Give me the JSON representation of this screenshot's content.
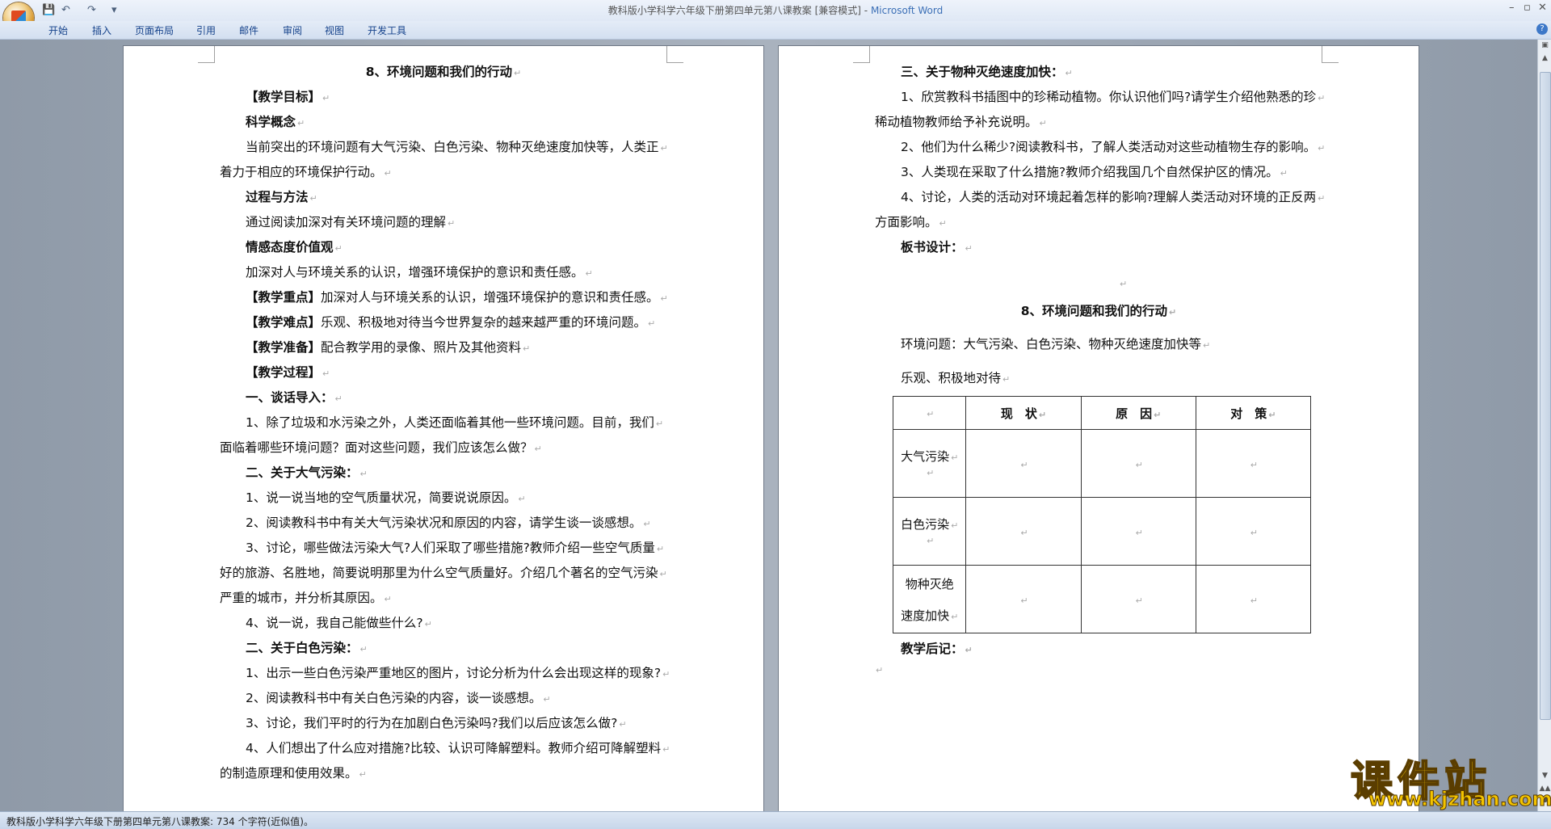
{
  "window": {
    "title": "教科版小学科学六年级下册第四单元第八课教案 [兼容模式]",
    "app_name": "Microsoft Word",
    "quick_access": [
      "save-icon",
      "undo-icon",
      "redo-icon",
      "customize-icon"
    ]
  },
  "ribbon": {
    "tabs": [
      "开始",
      "插入",
      "页面布局",
      "引用",
      "邮件",
      "审阅",
      "视图",
      "开发工具"
    ]
  },
  "page1": {
    "lines": [
      {
        "text": "8、环境问题和我们的行动",
        "bold": true,
        "style": "title"
      },
      {
        "text": "【教学目标】",
        "bold": true,
        "style": "indent"
      },
      {
        "text": "科学概念",
        "bold": true,
        "style": "indent"
      },
      {
        "text": "当前突出的环境问题有大气污染、白色污染、物种灭绝速度加快等，人类正",
        "bold": false,
        "style": "indent"
      },
      {
        "text": "着力于相应的环境保护行动。",
        "bold": false,
        "style": "flush"
      },
      {
        "text": "过程与方法",
        "bold": true,
        "style": "indent"
      },
      {
        "text": "通过阅读加深对有关环境问题的理解",
        "bold": false,
        "style": "indent"
      },
      {
        "text": "情感态度价值观",
        "bold": true,
        "style": "indent"
      },
      {
        "text": "加深对人与环境关系的认识，增强环境保护的意识和责任感。",
        "bold": false,
        "style": "indent"
      },
      {
        "label": "【教学重点】",
        "text": "加深对人与环境关系的认识，增强环境保护的意识和责任感。",
        "style": "indent"
      },
      {
        "label": "【教学难点】",
        "text": "乐观、积极地对待当今世界复杂的越来越严重的环境问题。",
        "style": "indent"
      },
      {
        "label": "【教学准备】",
        "text": "配合教学用的录像、照片及其他资料",
        "style": "indent"
      },
      {
        "text": "【教学过程】",
        "bold": true,
        "style": "indent"
      },
      {
        "text": "一、谈话导入：",
        "bold": true,
        "style": "indent"
      },
      {
        "text": "1、除了垃圾和水污染之外，人类还面临着其他一些环境问题。目前，我们",
        "bold": false,
        "style": "indent"
      },
      {
        "text": "面临着哪些环境问题？面对这些问题，我们应该怎么做？",
        "bold": false,
        "style": "flush"
      },
      {
        "text": "二、关于大气污染：",
        "bold": true,
        "style": "indent"
      },
      {
        "text": "1、说一说当地的空气质量状况，简要说说原因。",
        "bold": false,
        "style": "indent"
      },
      {
        "text": "2、阅读教科书中有关大气污染状况和原因的内容，请学生谈一谈感想。",
        "bold": false,
        "style": "indent"
      },
      {
        "text": "3、讨论，哪些做法污染大气?人们采取了哪些措施?教师介绍一些空气质量",
        "bold": false,
        "style": "indent"
      },
      {
        "text": "好的旅游、名胜地，简要说明那里为什么空气质量好。介绍几个著名的空气污染",
        "bold": false,
        "style": "flush"
      },
      {
        "text": "严重的城市，并分析其原因。",
        "bold": false,
        "style": "flush"
      },
      {
        "text": "4、说一说，我自己能做些什么?",
        "bold": false,
        "style": "indent"
      },
      {
        "text": "二、关于白色污染：",
        "bold": true,
        "style": "indent"
      },
      {
        "text": "1、出示一些白色污染严重地区的图片，讨论分析为什么会出现这样的现象?",
        "bold": false,
        "style": "indent"
      },
      {
        "text": "2、阅读教科书中有关白色污染的内容，谈一谈感想。",
        "bold": false,
        "style": "indent"
      },
      {
        "text": "3、讨论，我们平时的行为在加剧白色污染吗?我们以后应该怎么做?",
        "bold": false,
        "style": "indent"
      },
      {
        "text": "4、人们想出了什么应对措施?比较、认识可降解塑料。教师介绍可降解塑料",
        "bold": false,
        "style": "indent"
      },
      {
        "text": "的制造原理和使用效果。",
        "bold": false,
        "style": "flush"
      }
    ]
  },
  "page2": {
    "lines": [
      {
        "text": "三、关于物种灭绝速度加快：",
        "bold": true,
        "style": "indent"
      },
      {
        "text": "1、欣赏教科书插图中的珍稀动植物。你认识他们吗?请学生介绍他熟悉的珍",
        "bold": false,
        "style": "indent"
      },
      {
        "text": "稀动植物教师给予补充说明。",
        "bold": false,
        "style": "flush"
      },
      {
        "text": "2、他们为什么稀少?阅读教科书，了解人类活动对这些动植物生存的影响。",
        "bold": false,
        "style": "indent"
      },
      {
        "text": "3、人类现在采取了什么措施?教师介绍我国几个自然保护区的情况。",
        "bold": false,
        "style": "indent"
      },
      {
        "text": "4、讨论，人类的活动对环境起着怎样的影响?理解人类活动对环境的正反两",
        "bold": false,
        "style": "indent"
      },
      {
        "text": "方面影响。",
        "bold": false,
        "style": "flush"
      },
      {
        "text": "板书设计：",
        "bold": true,
        "style": "indent"
      }
    ],
    "board_title": "8、环境问题和我们的行动",
    "board_line1": "环境问题：大气污染、白色污染、物种灭绝速度加快等",
    "board_line2": "乐观、积极地对待",
    "table": {
      "headers": [
        "",
        "现　状",
        "原　因",
        "对　策"
      ],
      "rows": [
        {
          "label": "大气污染"
        },
        {
          "label": "白色污染"
        },
        {
          "label_line1": "物种灭绝",
          "label_line2": "速度加快"
        }
      ]
    },
    "postscript": "教学后记："
  },
  "statusbar": {
    "text": "教科版小学科学六年级下册第四单元第八课教案: 734 个字符(近似值)。"
  },
  "watermark": {
    "text": "课件站",
    "url": "www.kjzhan.com"
  }
}
